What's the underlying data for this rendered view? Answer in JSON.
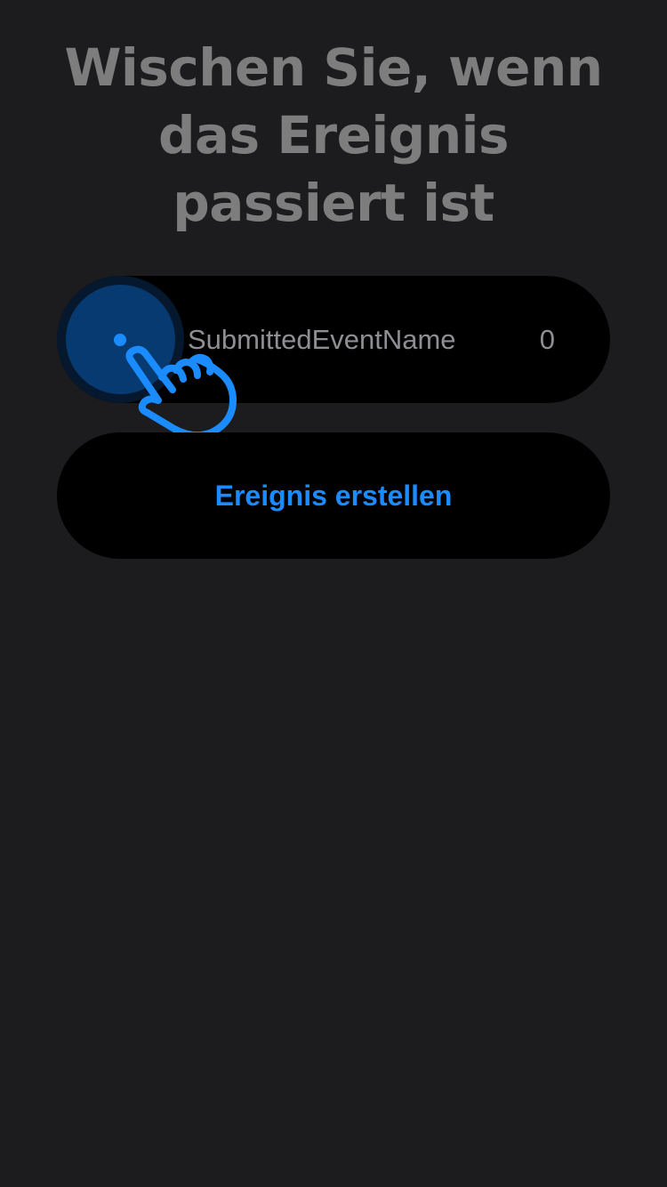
{
  "page": {
    "title": "Wischen Sie, wenn das Ereignis passiert ist"
  },
  "event_slider": {
    "event_name": "SubmittedEventName",
    "count": "0",
    "knob_icon": "drag-knob-icon",
    "gesture_icon": "hand-swipe-icon"
  },
  "actions": {
    "create_label": "Ereignis erstellen"
  },
  "colors": {
    "background": "#1c1c1e",
    "accent": "#1a8cff",
    "title_text": "#7d7d7d",
    "secondary_text": "#8e8e93",
    "row_background": "#000000"
  }
}
